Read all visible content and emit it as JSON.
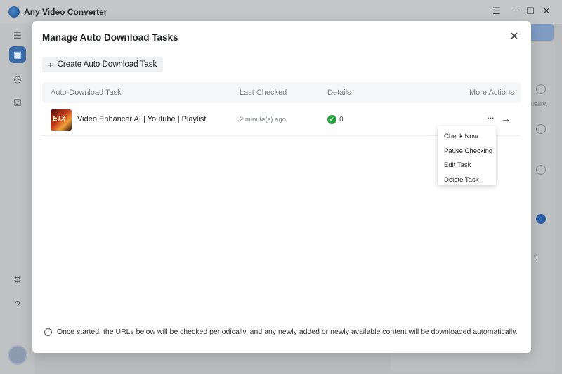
{
  "app": {
    "title": "Any Video Converter",
    "window_controls": [
      "menu-icon",
      "minimize-icon",
      "maximize-icon",
      "close-icon"
    ],
    "sidebar_icons": [
      "menu-icon",
      "briefcase-icon",
      "clock-icon",
      "checklist-icon",
      "settings-icon",
      "help-icon",
      "avatar"
    ],
    "bg_texts": {
      "quality": "uality.",
      "paren": "t)"
    }
  },
  "modal": {
    "title": "Manage Auto Download Tasks",
    "create_button": "Create Auto Download Task",
    "table": {
      "headers": {
        "task": "Auto-Download Task",
        "last_checked": "Last Checked",
        "details": "Details",
        "more_actions": "More Actions"
      },
      "rows": [
        {
          "thumb_text": "ETX",
          "name": "Video Enhancer AI | Youtube | Playlist",
          "last_checked": "2 minute(s) ago",
          "details_count": "0"
        }
      ]
    },
    "menu": {
      "items": [
        "Check Now",
        "Pause Checking",
        "Edit Task",
        "Delete Task"
      ]
    },
    "footer_note": "Once started, the URLs below will be checked periodically, and any newly added or newly available content will be downloaded automatically."
  },
  "colors": {
    "accent": "#2b5ea4",
    "success": "#2ea043"
  }
}
